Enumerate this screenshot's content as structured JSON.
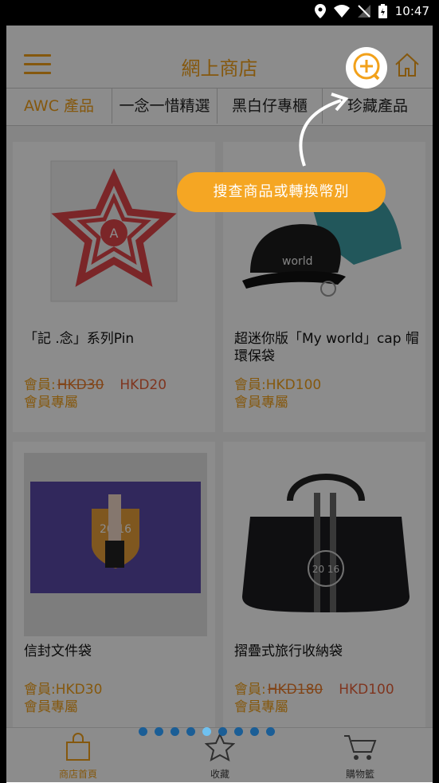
{
  "status_bar": {
    "time": "10:47"
  },
  "header": {
    "title": "網上商店"
  },
  "tabs": [
    {
      "label": "AWC 產品",
      "active": true
    },
    {
      "label": "一念一惜精選",
      "active": false
    },
    {
      "label": "黑白仔專櫃",
      "active": false
    },
    {
      "label": "珍藏產品",
      "active": false
    }
  ],
  "products": [
    {
      "name": "「記 .念」系列Pin",
      "price_prefix": "會員:",
      "old_price": "HKD30",
      "price": "HKD20",
      "member_note": "會員專屬"
    },
    {
      "name": "超迷你版「My world」cap 帽環保袋",
      "price_prefix": "會員:",
      "price": "HKD100",
      "member_note": "會員專屬"
    },
    {
      "name": "信封文件袋",
      "price_prefix": "會員:",
      "price": "HKD30",
      "member_note": "會員專屬"
    },
    {
      "name": "摺疊式旅行收納袋",
      "price_prefix": "會員:",
      "old_price": "HKD180",
      "price": "HKD100",
      "member_note": "會員專屬"
    }
  ],
  "bottom_nav": [
    {
      "label": "商店首頁",
      "icon": "shopping-bag-icon",
      "active": true
    },
    {
      "label": "收藏",
      "icon": "star-icon",
      "active": false
    },
    {
      "label": "購物籃",
      "icon": "cart-icon",
      "active": false
    }
  ],
  "tutorial": {
    "tooltip": "搜查商品或轉換幣別",
    "page_count": 9,
    "current_page": 5
  },
  "colors": {
    "accent": "#f2a11a",
    "tooltip": "#f5a623",
    "price_red": "#e8623a"
  }
}
